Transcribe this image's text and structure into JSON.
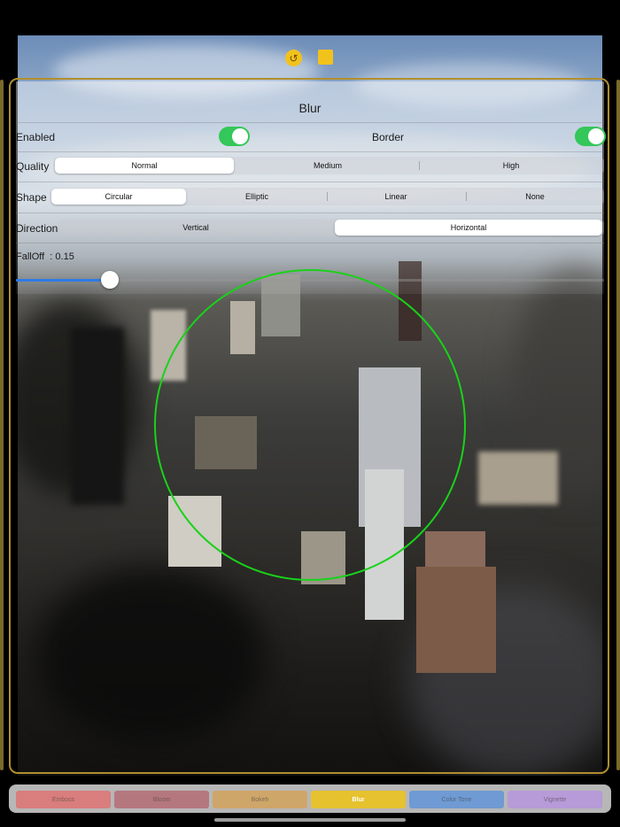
{
  "colors": {
    "accent_yellow": "#f2c21c",
    "toggle_on": "#34c759",
    "slider_blue": "#2f7ae5",
    "focus_circle": "#19d219",
    "frame_gold": "#b08e2e"
  },
  "top_bar": {
    "undo_icon": "undo-icon",
    "undo_glyph": "↺",
    "stop_icon": "stop-icon"
  },
  "panel": {
    "title": "Blur",
    "enabled_label": "Enabled",
    "enabled_on": true,
    "border_label": "Border",
    "border_on": true,
    "quality": {
      "label": "Quality",
      "options": [
        "Normal",
        "Medium",
        "High"
      ],
      "selected": "Normal"
    },
    "shape": {
      "label": "Shape",
      "options": [
        "Circular",
        "Elliptic",
        "Linear",
        "None"
      ],
      "selected": "Circular"
    },
    "direction": {
      "label": "Direction",
      "options": [
        "Vertical",
        "Horizontal"
      ],
      "selected": "Horizontal"
    },
    "falloff": {
      "label": "FallOff  : 0.15",
      "value": 0.15
    }
  },
  "filters": {
    "items": [
      {
        "label": "Emboss",
        "color": "#d97d7d"
      },
      {
        "label": "Bloom",
        "color": "#b5777e"
      },
      {
        "label": "Bokeh",
        "color": "#cfa66a"
      },
      {
        "label": "Blur",
        "color": "#e6c22e"
      },
      {
        "label": "Color Tone",
        "color": "#6f9ad3"
      },
      {
        "label": "Vignette",
        "color": "#b79ad8"
      }
    ],
    "selected": "Blur"
  }
}
